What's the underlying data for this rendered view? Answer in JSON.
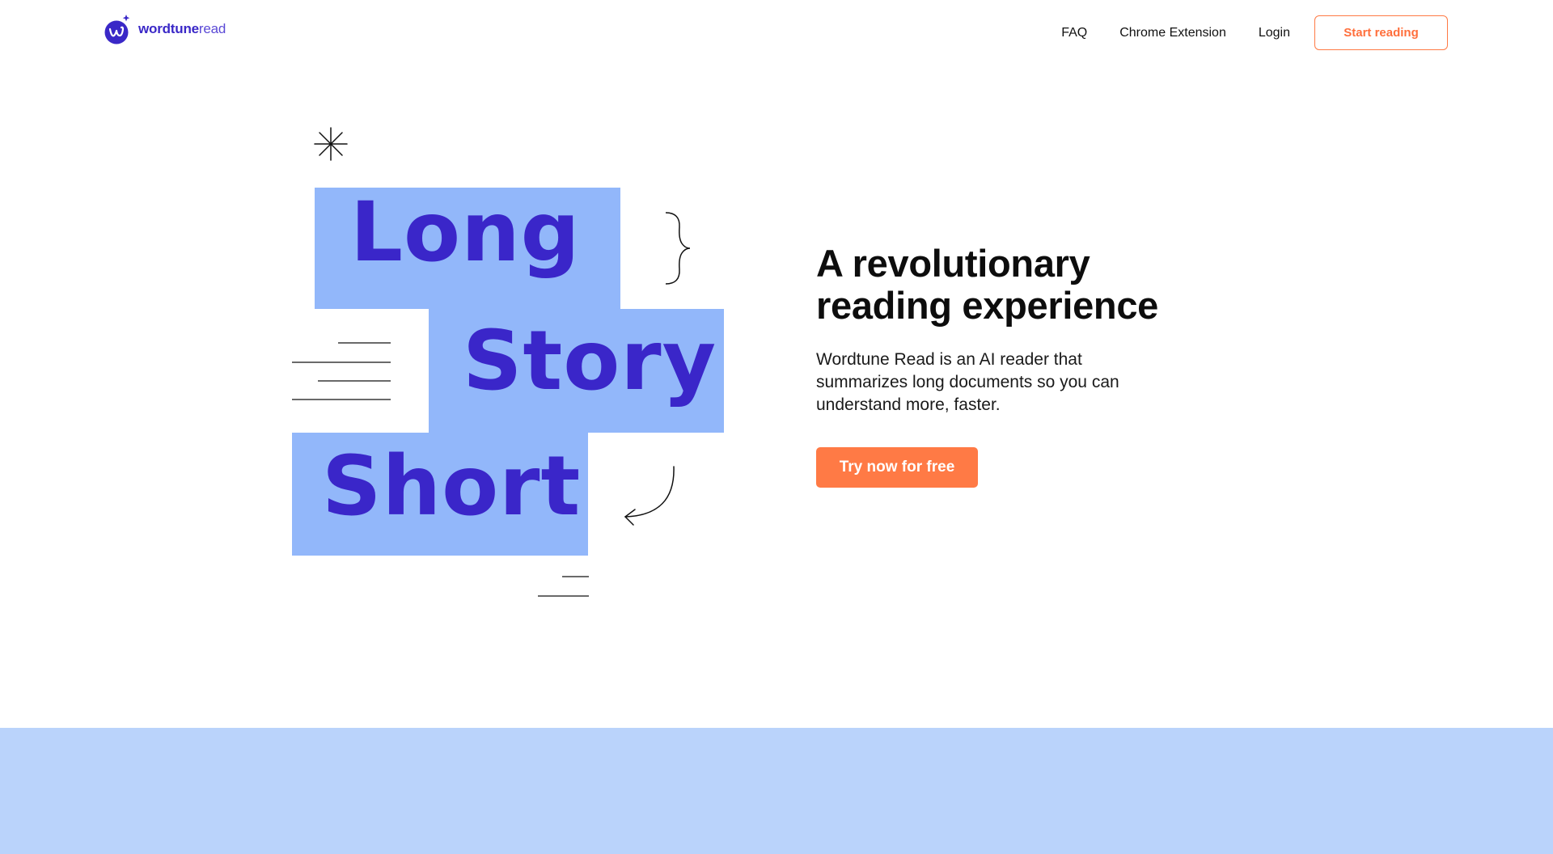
{
  "header": {
    "logo_brand": "wordtune",
    "logo_product": "read",
    "nav": [
      "FAQ",
      "Chrome Extension",
      "Login"
    ],
    "start_label": "Start reading"
  },
  "hero": {
    "illustration_words": [
      "Long",
      "Story",
      "Short"
    ],
    "title_line1": "A revolutionary",
    "title_line2": "reading experience",
    "subtitle": "Wordtune Read is an AI reader that summarizes long documents so you can understand more, faster.",
    "cta_label": "Try now for free"
  },
  "colors": {
    "brand": "#3a28c7",
    "accent": "#ff7a45",
    "illustration_block": "#92b7fa",
    "band": "#bad3fb"
  },
  "icons": [
    "wordtune-logo-icon",
    "sparkle-asterisk-icon",
    "curly-brace-icon",
    "curved-arrow-icon"
  ]
}
